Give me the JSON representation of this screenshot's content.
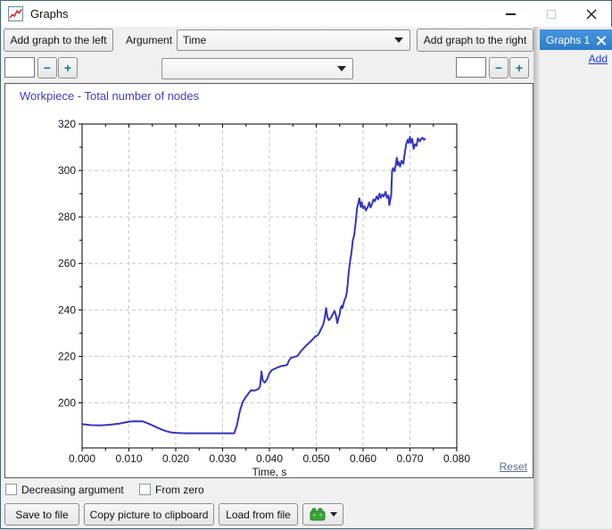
{
  "window": {
    "title": "Graphs"
  },
  "toolbar": {
    "add_left": "Add graph to the left",
    "argument_label": "Argument",
    "argument_value": "Time",
    "add_right": "Add graph to the right"
  },
  "row2": {
    "left_spin_value": "",
    "minus_label": "−",
    "plus_label": "+",
    "series_combo_value": "",
    "right_spin_value": ""
  },
  "right_panel": {
    "tab_label": "Graphs 1",
    "add_link": "Add"
  },
  "options": {
    "decreasing_label": "Decreasing argument",
    "from_zero_label": "From zero"
  },
  "actions": {
    "save_label": "Save to file",
    "copy_label": "Copy picture to clipboard",
    "load_label": "Load from file"
  },
  "chart_footer": {
    "reset_label": "Reset"
  },
  "colors": {
    "tab_accent": "#3b8ad9",
    "link_blue": "#2038e8",
    "spin_glyph": "#0e7c8c"
  },
  "chart_data": {
    "type": "line",
    "title": "Workpiece - Total number of nodes",
    "title_color": "#3d3dcb",
    "xlabel": "Time, s",
    "ylabel": "",
    "xlim": [
      0,
      0.08
    ],
    "ylim": [
      180.6,
      320
    ],
    "x_ticks": [
      "0.000",
      "0.010",
      "0.020",
      "0.030",
      "0.040",
      "0.050",
      "0.060",
      "0.070",
      "0.080"
    ],
    "y_ticks": [
      200,
      220,
      240,
      260,
      280,
      300,
      320
    ],
    "grid": true,
    "grid_color": "#c9c9c9",
    "line_color": "#3535bb",
    "legend_position": "none",
    "series": [
      {
        "name": "Workpiece - Total number of nodes",
        "points": [
          [
            0,
            190.8
          ],
          [
            0.002,
            190.4
          ],
          [
            0.004,
            190.3
          ],
          [
            0.006,
            190.6
          ],
          [
            0.008,
            191.1
          ],
          [
            0.009,
            191.5
          ],
          [
            0.01,
            191.9
          ],
          [
            0.011,
            192.1
          ],
          [
            0.013,
            192.0
          ],
          [
            0.014,
            191.2
          ],
          [
            0.015,
            190.3
          ],
          [
            0.016,
            189.4
          ],
          [
            0.017,
            188.5
          ],
          [
            0.018,
            187.8
          ],
          [
            0.019,
            187.3
          ],
          [
            0.02,
            187.1
          ],
          [
            0.022,
            186.9
          ],
          [
            0.026,
            186.9
          ],
          [
            0.03,
            186.9
          ],
          [
            0.0325,
            186.9
          ],
          [
            0.033,
            190.0
          ],
          [
            0.0337,
            196.5
          ],
          [
            0.0343,
            200.4
          ],
          [
            0.0349,
            202.3
          ],
          [
            0.0356,
            204.2
          ],
          [
            0.0361,
            205.5
          ],
          [
            0.0366,
            205.2
          ],
          [
            0.0371,
            205.5
          ],
          [
            0.0376,
            205.9
          ],
          [
            0.038,
            207.0
          ],
          [
            0.0383,
            213.5
          ],
          [
            0.0386,
            209.5
          ],
          [
            0.039,
            208.7
          ],
          [
            0.0395,
            210.2
          ],
          [
            0.04,
            212.8
          ],
          [
            0.0406,
            214.2
          ],
          [
            0.0412,
            214.7
          ],
          [
            0.0419,
            215.4
          ],
          [
            0.0425,
            215.8
          ],
          [
            0.0432,
            216.0
          ],
          [
            0.0438,
            216.4
          ],
          [
            0.0442,
            218.2
          ],
          [
            0.0446,
            219.4
          ],
          [
            0.0452,
            219.7
          ],
          [
            0.046,
            220.2
          ],
          [
            0.0467,
            222.2
          ],
          [
            0.0473,
            223.5
          ],
          [
            0.0479,
            224.8
          ],
          [
            0.0486,
            226.0
          ],
          [
            0.0492,
            227.3
          ],
          [
            0.0498,
            228.6
          ],
          [
            0.0502,
            228.9
          ],
          [
            0.0506,
            229.9
          ],
          [
            0.0509,
            231.2
          ],
          [
            0.0512,
            232.5
          ],
          [
            0.0515,
            233.8
          ],
          [
            0.0518,
            236.3
          ],
          [
            0.0521,
            240.8
          ],
          [
            0.0524,
            236.9
          ],
          [
            0.0527,
            235.6
          ],
          [
            0.053,
            236.3
          ],
          [
            0.0534,
            237.6
          ],
          [
            0.0537,
            238.9
          ],
          [
            0.0539,
            239.5
          ],
          [
            0.0542,
            237.5
          ],
          [
            0.0545,
            234.3
          ],
          [
            0.0547,
            236.3
          ],
          [
            0.055,
            238.2
          ],
          [
            0.0552,
            240.8
          ],
          [
            0.0554,
            241.7
          ],
          [
            0.0556,
            240.8
          ],
          [
            0.0558,
            242.4
          ],
          [
            0.056,
            244.0
          ],
          [
            0.0563,
            245.5
          ],
          [
            0.0565,
            247.2
          ],
          [
            0.0567,
            251.0
          ],
          [
            0.0569,
            255.5
          ],
          [
            0.0572,
            260.6
          ],
          [
            0.0575,
            264.5
          ],
          [
            0.0578,
            269.6
          ],
          [
            0.0581,
            272.2
          ],
          [
            0.0584,
            277.3
          ],
          [
            0.0587,
            283.7
          ],
          [
            0.059,
            286.3
          ],
          [
            0.0592,
            288.0
          ],
          [
            0.0595,
            284.3
          ],
          [
            0.0597,
            286.3
          ],
          [
            0.06,
            283.7
          ],
          [
            0.0603,
            284.6
          ],
          [
            0.0606,
            282.8
          ],
          [
            0.061,
            284.3
          ],
          [
            0.0613,
            286.3
          ],
          [
            0.0616,
            284.1
          ],
          [
            0.0619,
            285.6
          ],
          [
            0.0622,
            287.5
          ],
          [
            0.0625,
            286.7
          ],
          [
            0.0629,
            288.8
          ],
          [
            0.0632,
            287.5
          ],
          [
            0.0635,
            290.1
          ],
          [
            0.0638,
            288.2
          ],
          [
            0.0641,
            289.7
          ],
          [
            0.0644,
            288.8
          ],
          [
            0.0648,
            290.8
          ],
          [
            0.0651,
            288.2
          ],
          [
            0.0654,
            289.2
          ],
          [
            0.0656,
            285.1
          ],
          [
            0.066,
            289.5
          ],
          [
            0.0662,
            299.7
          ],
          [
            0.0664,
            301.0
          ],
          [
            0.0667,
            299.7
          ],
          [
            0.067,
            302.9
          ],
          [
            0.0672,
            305.5
          ],
          [
            0.0674,
            302.3
          ],
          [
            0.0676,
            303.6
          ],
          [
            0.0679,
            301.7
          ],
          [
            0.0682,
            304.2
          ],
          [
            0.0686,
            302.9
          ],
          [
            0.0689,
            307.4
          ],
          [
            0.0692,
            311.3
          ],
          [
            0.0695,
            313.2
          ],
          [
            0.0697,
            311.9
          ],
          [
            0.07,
            314.5
          ],
          [
            0.0702,
            311.9
          ],
          [
            0.0705,
            313.6
          ],
          [
            0.0708,
            309.3
          ],
          [
            0.0711,
            311.3
          ],
          [
            0.0714,
            310.6
          ],
          [
            0.0717,
            313.8
          ],
          [
            0.0721,
            312.5
          ],
          [
            0.0724,
            313.6
          ],
          [
            0.0727,
            314.1
          ],
          [
            0.073,
            313.2
          ],
          [
            0.0733,
            313.8
          ]
        ]
      }
    ]
  }
}
